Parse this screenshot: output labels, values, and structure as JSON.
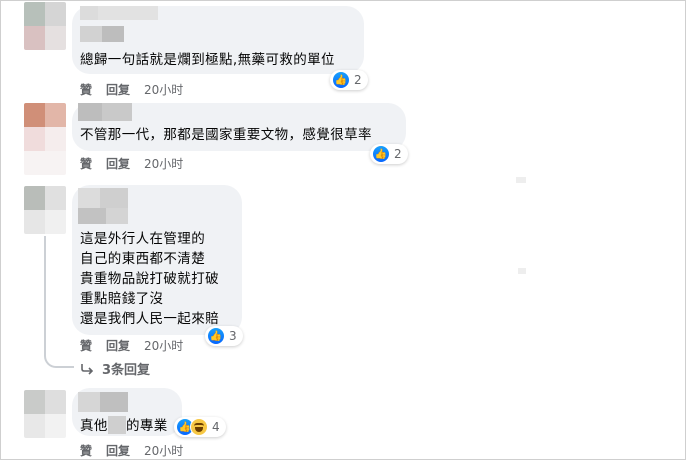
{
  "comments": [
    {
      "text": "總歸一句話就是爛到極點,無藥可救的單位",
      "reaction_count": "2",
      "like_label": "贊",
      "reply_label": "回复",
      "time": "20小时"
    },
    {
      "text": "不管那一代，那都是國家重要文物，感覺很草率",
      "reaction_count": "2",
      "like_label": "贊",
      "reply_label": "回复",
      "time": "20小时"
    },
    {
      "lines": [
        "這是外行人在管理的",
        "自己的東西都不清楚",
        "貴重物品說打破就打破",
        "重點賠錢了沒",
        "還是我們人民一起來賠"
      ],
      "reaction_count": "3",
      "like_label": "贊",
      "reply_label": "回复",
      "time": "20小时",
      "replies_label": "3条回复"
    },
    {
      "text_prefix": "真他",
      "text_suffix": "的專業",
      "reaction_count": "4",
      "like_label": "贊",
      "reply_label": "回复",
      "time": "20小时"
    }
  ],
  "colors": {
    "bubble": "#f0f2f5",
    "like_blue": "#0866ff",
    "meta_gray": "#65676b"
  },
  "icons": {
    "like": "thumbs-up-icon",
    "haha": "haha-icon",
    "reply_arrow": "reply-arrow-icon"
  }
}
